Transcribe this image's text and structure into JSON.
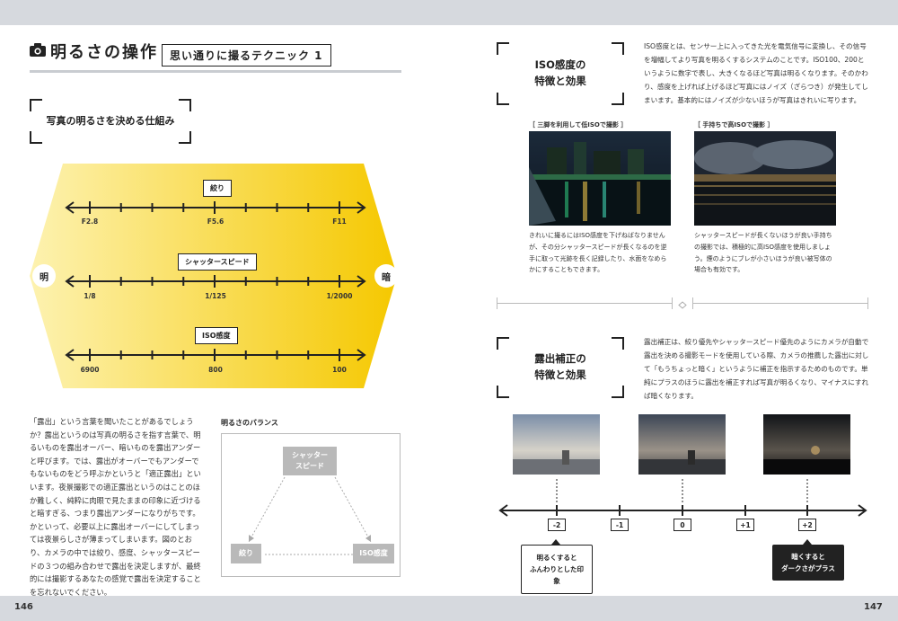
{
  "left": {
    "section_title": "明るさの操作",
    "technique_label": "思い通りに撮るテクニック 1",
    "frame_title": "写真の明るさを決める仕組み",
    "side_dark_left": "明",
    "side_light_right": "暗",
    "scales": [
      {
        "label": "絞り",
        "ticks": [
          "F2.8",
          "F5.6",
          "F11"
        ]
      },
      {
        "label": "シャッタースピード",
        "ticks": [
          "1/8",
          "1/125",
          "1/2000"
        ]
      },
      {
        "label": "ISO感度",
        "ticks": [
          "6900",
          "800",
          "100"
        ]
      }
    ],
    "body_text": "「露出」という言葉を聞いたことがあるでしょうか？露出というのは写真の明るさを指す言葉で、明るいものを露出オーバー、暗いものを露出アンダーと呼びます。では、露出がオーバーでもアンダーでもないものをどう呼ぶかというと「適正露出」といいます。夜景撮影での適正露出というのはことのほか難しく、純粋に肉眼で見たままの印象に近づけると暗すぎる、つまり露出アンダーになりがちです。かといって、必要以上に露出オーバーにしてしまっては夜景らしさが薄まってしまいます。図のとおり、カメラの中では絞り、感度、シャッタースピードの３つの組み合わせで露出を決定しますが、最終的には撮影するあなたの感覚で露出を決定することを忘れないでください。",
    "balance_title": "明るさのバランス",
    "balance_top": "シャッター\nスピード",
    "balance_left": "絞り",
    "balance_right": "ISO感度",
    "page_number": "146"
  },
  "right": {
    "iso_title": "ISO感度の\n特徴と効果",
    "iso_text": "ISO感度とは、センサー上に入ってきた光を電気信号に変換し、その信号を増幅してより写真を明るくするシステムのことです。ISO100、200というように数字で表し、大きくなるほど写真は明るくなります。そのかわり、感度を上げれば上げるほど写真にはノイズ（ざらつき）が発生してしまいます。基本的にはノイズが少ないほうが写真はきれいに写ります。",
    "photo1_caption": "［ 三脚を利用して低ISOで撮影 ］",
    "photo1_text": "きれいに撮るにはISO感度を下げねばなりませんが、その分シャッタースピードが長くなるのを逆手に取って光跡を長く記録したり、水面をなめらかにすることもできます。",
    "photo2_caption": "［ 手持ちで高ISOで撮影 ］",
    "photo2_text": "シャッタースピードが長くないほうが良い手持ちの撮影では、積極的に高ISO感度を使用しましょう。煙のようにブレが小さいほうが良い被写体の場合も有効です。",
    "exp_title": "露出補正の\n特徴と効果",
    "exp_text": "露出補正は、絞り優先やシャッタースピード優先のようにカメラが自動で露出を決める撮影モードを使用している際、カメラの推薦した露出に対して「もうちょっと暗く」というように補正を指示するためのものです。単純にプラスのほうに露出を補正すれば写真が明るくなり、マイナスにすれば暗くなります。",
    "ev_labels": [
      "-2",
      "-1",
      "0",
      "+1",
      "+2"
    ],
    "note_bright": "明るくすると\nふんわりとした印象",
    "note_dark": "暗くすると\nダークさがプラス",
    "page_number": "147"
  },
  "colors": {
    "yellow_dark": "#f5c800",
    "yellow_light": "#fdf2b0",
    "gray_box": "#b9b9b9",
    "bar": "#d6d9de"
  }
}
